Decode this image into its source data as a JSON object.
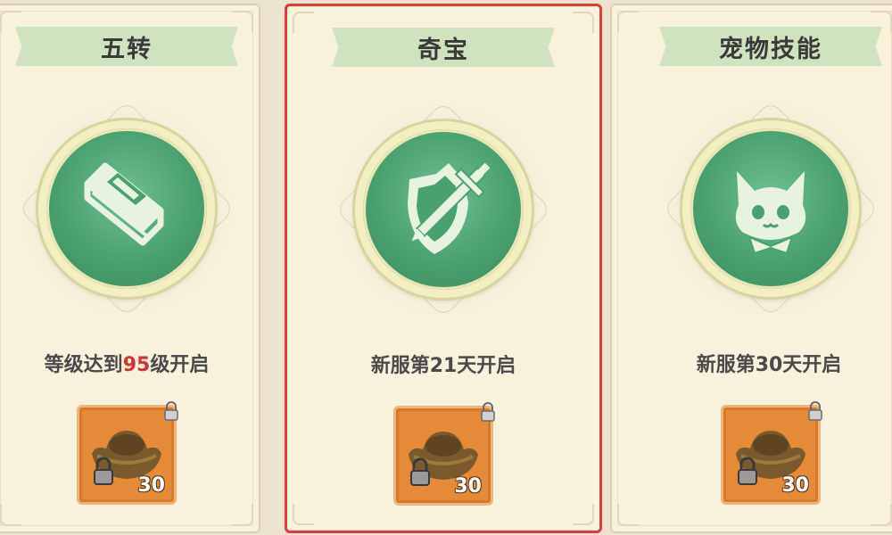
{
  "cards": [
    {
      "title": "五转",
      "emblem": "book-icon",
      "condition_prefix": "等级达到",
      "condition_highlight": "95",
      "condition_suffix": "级开启",
      "item": {
        "icon": "gold-ingot-icon",
        "quantity": "30",
        "locked": true
      }
    },
    {
      "title": "奇宝",
      "emblem": "shield-sword-icon",
      "selected": true,
      "condition_prefix": "新服第21天开启",
      "condition_highlight": "",
      "condition_suffix": "",
      "item": {
        "icon": "gold-ingot-icon",
        "quantity": "30",
        "locked": true
      }
    },
    {
      "title": "宠物技能",
      "emblem": "pet-cat-icon",
      "condition_prefix": "新服第30天开启",
      "condition_highlight": "",
      "condition_suffix": "",
      "item": {
        "icon": "gold-ingot-icon",
        "quantity": "30",
        "locked": true
      }
    }
  ],
  "colors": {
    "selection_border": "#e53a3a",
    "highlight_text": "#d63030",
    "emblem_green": "#4aa06f",
    "item_frame": "#e48a38"
  }
}
